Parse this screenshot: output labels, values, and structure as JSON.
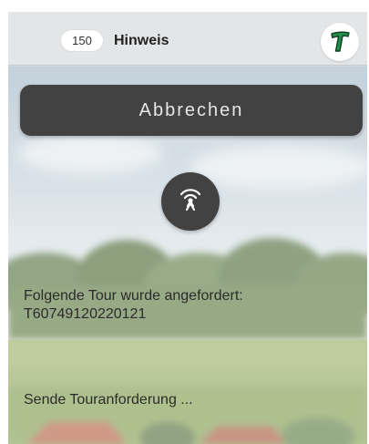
{
  "header": {
    "count": "150",
    "title": "Hinweis",
    "logo_icon": "t-logo-icon"
  },
  "actions": {
    "cancel_label": "Abbrechen",
    "signal_icon": "antenna-signal-icon"
  },
  "content": {
    "request_label": "Folgende Tour wurde angefordert:",
    "tour_id": "T60749120220121",
    "status_text": "Sende Touranforderung ..."
  },
  "colors": {
    "header_bg": "#e3e5e7",
    "button_bg": "#424242",
    "logo_green": "#1f8f4a"
  }
}
